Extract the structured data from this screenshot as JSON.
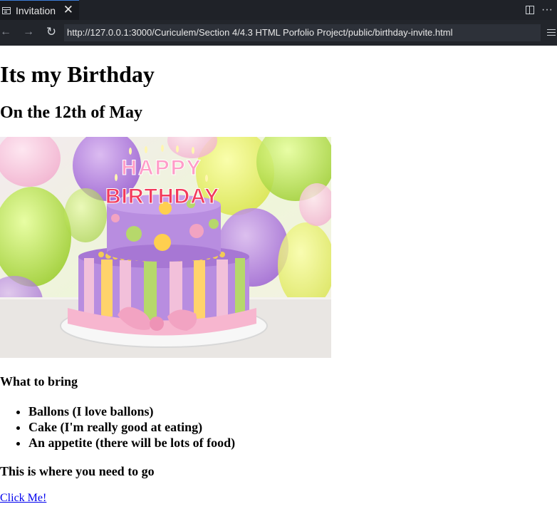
{
  "browser": {
    "tab": {
      "title": "Invitation",
      "close_glyph": "✕",
      "icon": "page-icon"
    },
    "actions": {
      "split_icon": "split-view-icon",
      "more_glyph": "···"
    },
    "nav": {
      "back_glyph": "←",
      "forward_glyph": "→",
      "reload_glyph": "↻",
      "url": "http://127.0.0.1:3000/Curiculem/Section 4/4.3 HTML Porfolio Project/public/birthday-invite.html"
    }
  },
  "page": {
    "title": "Its my Birthday",
    "subtitle": "On the 12th of May",
    "image_text": {
      "line1": "HAPPY",
      "line2": "BIRTHDAY"
    },
    "bring_heading": "What to bring",
    "bring_items": [
      "Ballons (I love ballons)",
      "Cake (I'm really good at eating)",
      "An appetite (there will be lots of food)"
    ],
    "where_heading": "This is where you need to go",
    "link_text": "Click Me!"
  },
  "colors": {
    "tabbar_bg": "#1f2228",
    "navbar_bg": "#22252b",
    "url_bg": "#2d3139",
    "link": "#0000ee"
  }
}
